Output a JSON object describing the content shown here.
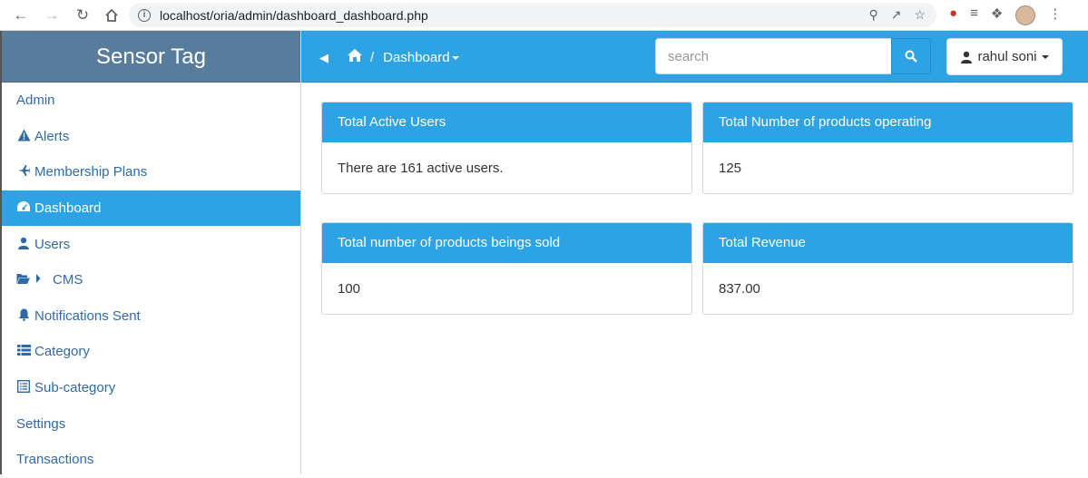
{
  "browser": {
    "url": "localhost/oria/admin/dashboard_dashboard.php"
  },
  "sidebar": {
    "brand": "Sensor Tag",
    "items": [
      {
        "label": "Admin",
        "icon": ""
      },
      {
        "label": "Alerts",
        "icon": "warning-icon"
      },
      {
        "label": "Membership Plans",
        "icon": "plane-icon"
      },
      {
        "label": "Dashboard",
        "icon": "dashboard-icon",
        "active": true
      },
      {
        "label": "Users",
        "icon": "user-icon"
      },
      {
        "label": "CMS",
        "icon": "folder-open-icon"
      },
      {
        "label": "Notifications Sent",
        "icon": "bell-icon"
      },
      {
        "label": "Category",
        "icon": "list-icon"
      },
      {
        "label": "Sub-category",
        "icon": "list-alt-icon"
      },
      {
        "label": "Settings",
        "icon": ""
      },
      {
        "label": "Transactions",
        "icon": ""
      }
    ]
  },
  "topbar": {
    "breadcrumb_sep": "/",
    "breadcrumb_current": "Dashboard",
    "search_placeholder": "search",
    "user_name": "rahul soni"
  },
  "panels": [
    {
      "title": "Total Active Users",
      "body": "There are 161 active users."
    },
    {
      "title": "Total Number of products operating",
      "body": "125"
    },
    {
      "title": "Total number of products beings sold",
      "body": "100"
    },
    {
      "title": "Total Revenue",
      "body": "837.00"
    }
  ],
  "colors": {
    "accent": "#2ea3e3",
    "brand_bg": "#587d9c",
    "link": "#2f6aa8"
  }
}
